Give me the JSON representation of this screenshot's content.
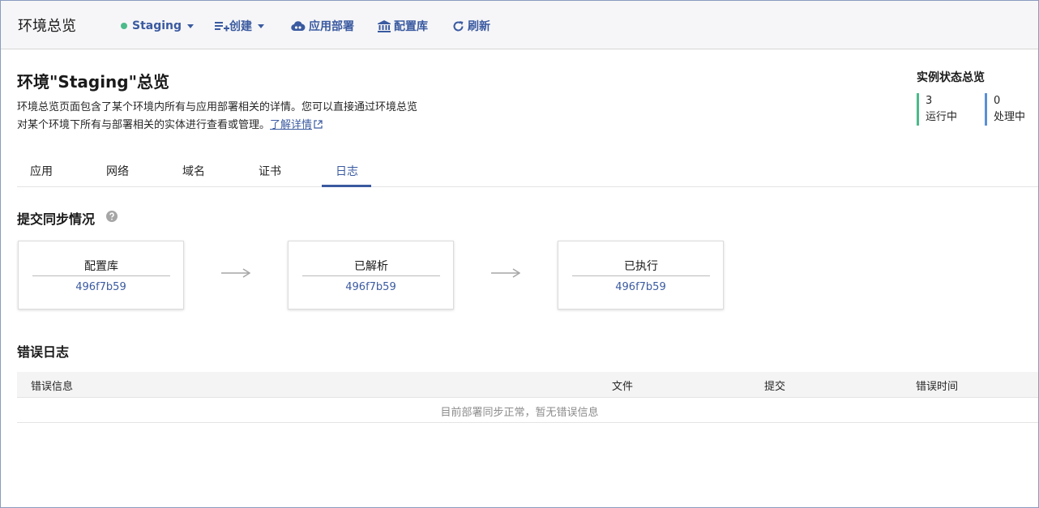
{
  "topbar": {
    "title": "环境总览",
    "env_selector": "Staging",
    "create_label": "创建",
    "deploy_label": "应用部署",
    "repo_label": "配置库",
    "refresh_label": "刷新"
  },
  "header": {
    "title": "环境\"Staging\"总览",
    "desc_line1": "环境总览页面包含了某个环境内所有与应用部署相关的详情。您可以直接通过环境总览",
    "desc_line2": "对某个环境下所有与部署相关的实体进行查看或管理。",
    "learn_more": "了解详情"
  },
  "instance_status": {
    "title": "实例状态总览",
    "running": {
      "count": "3",
      "label": "运行中",
      "color": "#4cba8a"
    },
    "processing": {
      "count": "0",
      "label": "处理中",
      "color": "#5b8fd6"
    }
  },
  "tabs": [
    {
      "label": "应用"
    },
    {
      "label": "网络"
    },
    {
      "label": "域名"
    },
    {
      "label": "证书"
    },
    {
      "label": "日志"
    }
  ],
  "active_tab": "日志",
  "sync": {
    "title": "提交同步情况",
    "cards": [
      {
        "label": "配置库",
        "hash": "496f7b59"
      },
      {
        "label": "已解析",
        "hash": "496f7b59"
      },
      {
        "label": "已执行",
        "hash": "496f7b59"
      }
    ]
  },
  "error_log": {
    "title": "错误日志",
    "columns": [
      "错误信息",
      "文件",
      "提交",
      "错误时间"
    ],
    "empty_text": "目前部署同步正常，暂无错误信息"
  },
  "colors": {
    "accent": "#3a5aa0",
    "running": "#4cba8a",
    "processing": "#5b8fd6"
  }
}
